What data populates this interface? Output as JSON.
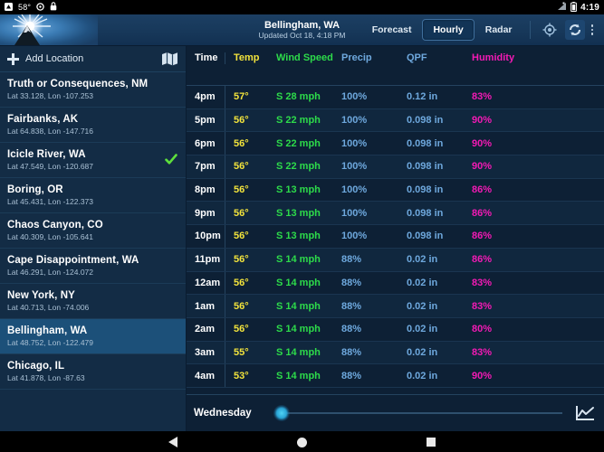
{
  "statusbar": {
    "temp": "58°",
    "clock": "4:19",
    "icons": [
      "app-icon",
      "circle-icon",
      "lock-icon",
      "signal-icon",
      "battery-icon"
    ]
  },
  "header": {
    "title": "Bellingham, WA",
    "subtitle": "Updated Oct 18, 4:18 PM",
    "logo": "sun-over-mountain-logo",
    "tabs": [
      {
        "label": "Forecast",
        "active": false
      },
      {
        "label": "Hourly",
        "active": true
      },
      {
        "label": "Radar",
        "active": false
      }
    ],
    "actions": [
      {
        "name": "my-location-icon"
      },
      {
        "name": "refresh-icon"
      },
      {
        "name": "overflow-menu-icon"
      }
    ]
  },
  "sidebar": {
    "add_location_label": "Add Location",
    "map_icon": "map-icon",
    "locations": [
      {
        "name": "Truth or Consequences, NM",
        "coords": "Lat 33.128, Lon -107.253",
        "selected": false,
        "checked": false
      },
      {
        "name": "Fairbanks, AK",
        "coords": "Lat 64.838, Lon -147.716",
        "selected": false,
        "checked": false
      },
      {
        "name": "Icicle River, WA",
        "coords": "Lat 47.549, Lon -120.687",
        "selected": false,
        "checked": true
      },
      {
        "name": "Boring, OR",
        "coords": "Lat 45.431, Lon -122.373",
        "selected": false,
        "checked": false
      },
      {
        "name": "Chaos Canyon, CO",
        "coords": "Lat 40.309, Lon -105.641",
        "selected": false,
        "checked": false
      },
      {
        "name": "Cape Disappointment, WA",
        "coords": "Lat 46.291, Lon -124.072",
        "selected": false,
        "checked": false
      },
      {
        "name": "New York, NY",
        "coords": "Lat 40.713, Lon -74.006",
        "selected": false,
        "checked": false
      },
      {
        "name": "Bellingham, WA",
        "coords": "Lat 48.752, Lon -122.479",
        "selected": true,
        "checked": false
      },
      {
        "name": "Chicago, IL",
        "coords": "Lat 41.878, Lon -87.63",
        "selected": false,
        "checked": false
      }
    ]
  },
  "table": {
    "columns": [
      {
        "label": "Time",
        "color": "#ffffff"
      },
      {
        "label": "Temp",
        "color": "#f2e33c"
      },
      {
        "label": "Wind Speed",
        "color": "#2ddb4a"
      },
      {
        "label": "Precip",
        "color": "#6ea8dd"
      },
      {
        "label": "QPF",
        "color": "#6ea8dd"
      },
      {
        "label": "Humidity",
        "color": "#f21ab4"
      }
    ],
    "rows": [
      {
        "time": "4pm",
        "temp": "57°",
        "wind": "S 28 mph",
        "precip": "100%",
        "qpf": "0.12 in",
        "humidity": "83%"
      },
      {
        "time": "5pm",
        "temp": "56°",
        "wind": "S 22 mph",
        "precip": "100%",
        "qpf": "0.098 in",
        "humidity": "90%"
      },
      {
        "time": "6pm",
        "temp": "56°",
        "wind": "S 22 mph",
        "precip": "100%",
        "qpf": "0.098 in",
        "humidity": "90%"
      },
      {
        "time": "7pm",
        "temp": "56°",
        "wind": "S 22 mph",
        "precip": "100%",
        "qpf": "0.098 in",
        "humidity": "90%"
      },
      {
        "time": "8pm",
        "temp": "56°",
        "wind": "S 13 mph",
        "precip": "100%",
        "qpf": "0.098 in",
        "humidity": "86%"
      },
      {
        "time": "9pm",
        "temp": "56°",
        "wind": "S 13 mph",
        "precip": "100%",
        "qpf": "0.098 in",
        "humidity": "86%"
      },
      {
        "time": "10pm",
        "temp": "56°",
        "wind": "S 13 mph",
        "precip": "100%",
        "qpf": "0.098 in",
        "humidity": "86%"
      },
      {
        "time": "11pm",
        "temp": "56°",
        "wind": "S 14 mph",
        "precip": "88%",
        "qpf": "0.02 in",
        "humidity": "86%"
      },
      {
        "time": "12am",
        "temp": "56°",
        "wind": "S 14 mph",
        "precip": "88%",
        "qpf": "0.02 in",
        "humidity": "83%"
      },
      {
        "time": "1am",
        "temp": "56°",
        "wind": "S 14 mph",
        "precip": "88%",
        "qpf": "0.02 in",
        "humidity": "83%"
      },
      {
        "time": "2am",
        "temp": "56°",
        "wind": "S 14 mph",
        "precip": "88%",
        "qpf": "0.02 in",
        "humidity": "80%"
      },
      {
        "time": "3am",
        "temp": "55°",
        "wind": "S 14 mph",
        "precip": "88%",
        "qpf": "0.02 in",
        "humidity": "83%"
      },
      {
        "time": "4am",
        "temp": "53°",
        "wind": "S 14 mph",
        "precip": "88%",
        "qpf": "0.02 in",
        "humidity": "90%"
      }
    ]
  },
  "footer": {
    "day_label": "Wednesday",
    "slider_name": "day-slider",
    "chart_icon": "line-chart-icon"
  },
  "navbar": {
    "back": "back-icon",
    "home": "home-icon",
    "recents": "recents-icon"
  }
}
